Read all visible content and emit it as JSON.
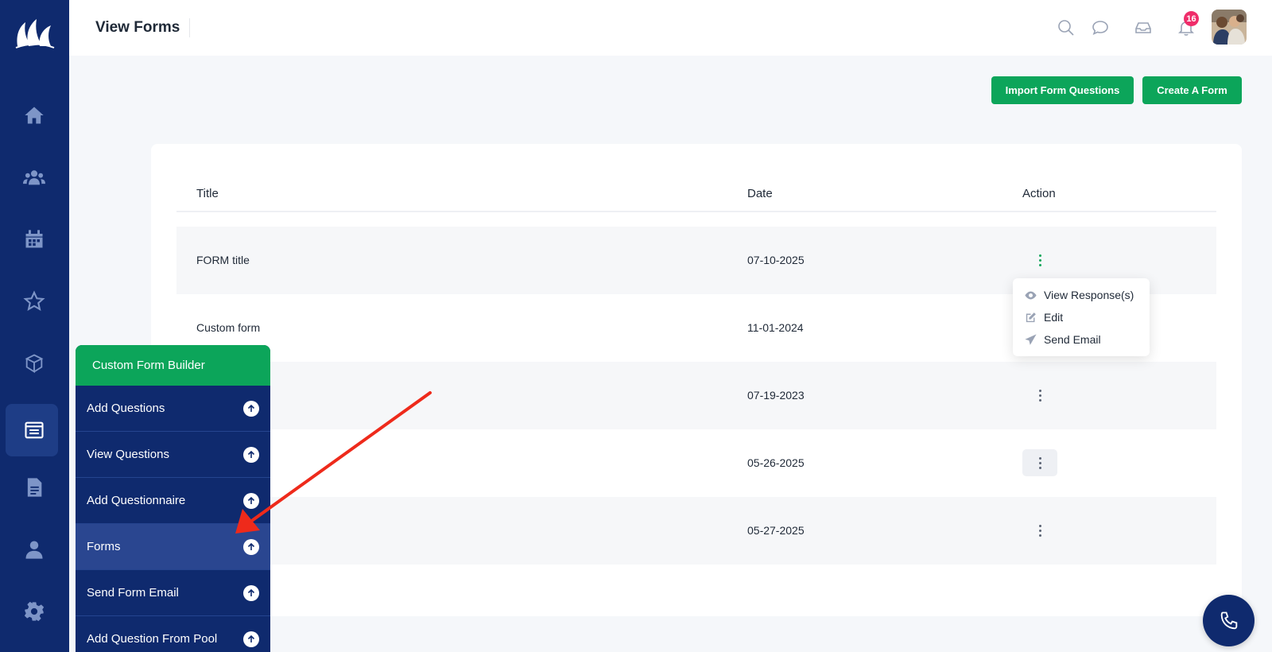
{
  "header": {
    "title": "View Forms",
    "notification_count": "16"
  },
  "sidebar": {
    "icons": [
      "home-icon",
      "users-icon",
      "calendar-icon",
      "star-icon",
      "box-icon",
      "forms-icon",
      "document-icon",
      "person-icon",
      "gear-icon"
    ],
    "active": "forms-icon"
  },
  "actions": {
    "import_label": "Import Form Questions",
    "create_label": "Create A Form"
  },
  "table": {
    "columns": [
      "Title",
      "Date",
      "Action"
    ],
    "rows": [
      {
        "title": "FORM title",
        "date": "07-10-2025"
      },
      {
        "title": "Custom form",
        "date": "11-01-2024"
      },
      {
        "title": "",
        "date": "07-19-2023"
      },
      {
        "title": "",
        "date": "05-26-2025"
      },
      {
        "title": "",
        "date": "05-27-2025"
      }
    ]
  },
  "dropdown": {
    "items": [
      "View Response(s)",
      "Edit",
      "Send Email"
    ]
  },
  "overlay_menu": {
    "header": "Custom Form Builder",
    "items": [
      "Add Questions",
      "View Questions",
      "Add Questionnaire",
      "Forms",
      "Send Form Email",
      "Add Question From Pool"
    ],
    "active": "Forms"
  },
  "colors": {
    "primary_navy": "#0f2a6e",
    "accent_green": "#0ca55a",
    "badge_pink": "#ef2d6a",
    "annotation_red": "#ee2a1b"
  }
}
